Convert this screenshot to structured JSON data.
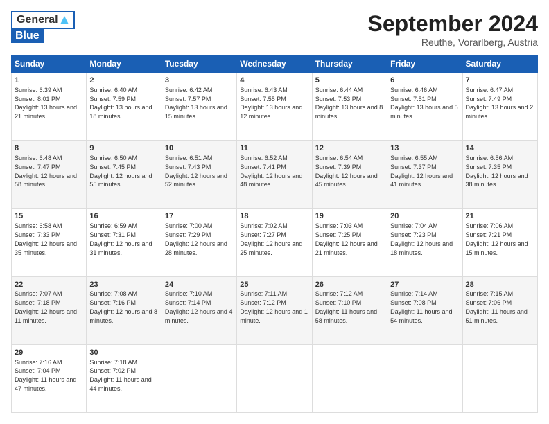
{
  "header": {
    "logo_general": "General",
    "logo_blue": "Blue",
    "month_title": "September 2024",
    "location": "Reuthe, Vorarlberg, Austria"
  },
  "weekdays": [
    "Sunday",
    "Monday",
    "Tuesday",
    "Wednesday",
    "Thursday",
    "Friday",
    "Saturday"
  ],
  "weeks": [
    [
      {
        "day": "1",
        "sunrise": "Sunrise: 6:39 AM",
        "sunset": "Sunset: 8:01 PM",
        "daylight": "Daylight: 13 hours and 21 minutes."
      },
      {
        "day": "2",
        "sunrise": "Sunrise: 6:40 AM",
        "sunset": "Sunset: 7:59 PM",
        "daylight": "Daylight: 13 hours and 18 minutes."
      },
      {
        "day": "3",
        "sunrise": "Sunrise: 6:42 AM",
        "sunset": "Sunset: 7:57 PM",
        "daylight": "Daylight: 13 hours and 15 minutes."
      },
      {
        "day": "4",
        "sunrise": "Sunrise: 6:43 AM",
        "sunset": "Sunset: 7:55 PM",
        "daylight": "Daylight: 13 hours and 12 minutes."
      },
      {
        "day": "5",
        "sunrise": "Sunrise: 6:44 AM",
        "sunset": "Sunset: 7:53 PM",
        "daylight": "Daylight: 13 hours and 8 minutes."
      },
      {
        "day": "6",
        "sunrise": "Sunrise: 6:46 AM",
        "sunset": "Sunset: 7:51 PM",
        "daylight": "Daylight: 13 hours and 5 minutes."
      },
      {
        "day": "7",
        "sunrise": "Sunrise: 6:47 AM",
        "sunset": "Sunset: 7:49 PM",
        "daylight": "Daylight: 13 hours and 2 minutes."
      }
    ],
    [
      {
        "day": "8",
        "sunrise": "Sunrise: 6:48 AM",
        "sunset": "Sunset: 7:47 PM",
        "daylight": "Daylight: 12 hours and 58 minutes."
      },
      {
        "day": "9",
        "sunrise": "Sunrise: 6:50 AM",
        "sunset": "Sunset: 7:45 PM",
        "daylight": "Daylight: 12 hours and 55 minutes."
      },
      {
        "day": "10",
        "sunrise": "Sunrise: 6:51 AM",
        "sunset": "Sunset: 7:43 PM",
        "daylight": "Daylight: 12 hours and 52 minutes."
      },
      {
        "day": "11",
        "sunrise": "Sunrise: 6:52 AM",
        "sunset": "Sunset: 7:41 PM",
        "daylight": "Daylight: 12 hours and 48 minutes."
      },
      {
        "day": "12",
        "sunrise": "Sunrise: 6:54 AM",
        "sunset": "Sunset: 7:39 PM",
        "daylight": "Daylight: 12 hours and 45 minutes."
      },
      {
        "day": "13",
        "sunrise": "Sunrise: 6:55 AM",
        "sunset": "Sunset: 7:37 PM",
        "daylight": "Daylight: 12 hours and 41 minutes."
      },
      {
        "day": "14",
        "sunrise": "Sunrise: 6:56 AM",
        "sunset": "Sunset: 7:35 PM",
        "daylight": "Daylight: 12 hours and 38 minutes."
      }
    ],
    [
      {
        "day": "15",
        "sunrise": "Sunrise: 6:58 AM",
        "sunset": "Sunset: 7:33 PM",
        "daylight": "Daylight: 12 hours and 35 minutes."
      },
      {
        "day": "16",
        "sunrise": "Sunrise: 6:59 AM",
        "sunset": "Sunset: 7:31 PM",
        "daylight": "Daylight: 12 hours and 31 minutes."
      },
      {
        "day": "17",
        "sunrise": "Sunrise: 7:00 AM",
        "sunset": "Sunset: 7:29 PM",
        "daylight": "Daylight: 12 hours and 28 minutes."
      },
      {
        "day": "18",
        "sunrise": "Sunrise: 7:02 AM",
        "sunset": "Sunset: 7:27 PM",
        "daylight": "Daylight: 12 hours and 25 minutes."
      },
      {
        "day": "19",
        "sunrise": "Sunrise: 7:03 AM",
        "sunset": "Sunset: 7:25 PM",
        "daylight": "Daylight: 12 hours and 21 minutes."
      },
      {
        "day": "20",
        "sunrise": "Sunrise: 7:04 AM",
        "sunset": "Sunset: 7:23 PM",
        "daylight": "Daylight: 12 hours and 18 minutes."
      },
      {
        "day": "21",
        "sunrise": "Sunrise: 7:06 AM",
        "sunset": "Sunset: 7:21 PM",
        "daylight": "Daylight: 12 hours and 15 minutes."
      }
    ],
    [
      {
        "day": "22",
        "sunrise": "Sunrise: 7:07 AM",
        "sunset": "Sunset: 7:18 PM",
        "daylight": "Daylight: 12 hours and 11 minutes."
      },
      {
        "day": "23",
        "sunrise": "Sunrise: 7:08 AM",
        "sunset": "Sunset: 7:16 PM",
        "daylight": "Daylight: 12 hours and 8 minutes."
      },
      {
        "day": "24",
        "sunrise": "Sunrise: 7:10 AM",
        "sunset": "Sunset: 7:14 PM",
        "daylight": "Daylight: 12 hours and 4 minutes."
      },
      {
        "day": "25",
        "sunrise": "Sunrise: 7:11 AM",
        "sunset": "Sunset: 7:12 PM",
        "daylight": "Daylight: 12 hours and 1 minute."
      },
      {
        "day": "26",
        "sunrise": "Sunrise: 7:12 AM",
        "sunset": "Sunset: 7:10 PM",
        "daylight": "Daylight: 11 hours and 58 minutes."
      },
      {
        "day": "27",
        "sunrise": "Sunrise: 7:14 AM",
        "sunset": "Sunset: 7:08 PM",
        "daylight": "Daylight: 11 hours and 54 minutes."
      },
      {
        "day": "28",
        "sunrise": "Sunrise: 7:15 AM",
        "sunset": "Sunset: 7:06 PM",
        "daylight": "Daylight: 11 hours and 51 minutes."
      }
    ],
    [
      {
        "day": "29",
        "sunrise": "Sunrise: 7:16 AM",
        "sunset": "Sunset: 7:04 PM",
        "daylight": "Daylight: 11 hours and 47 minutes."
      },
      {
        "day": "30",
        "sunrise": "Sunrise: 7:18 AM",
        "sunset": "Sunset: 7:02 PM",
        "daylight": "Daylight: 11 hours and 44 minutes."
      },
      null,
      null,
      null,
      null,
      null
    ]
  ]
}
